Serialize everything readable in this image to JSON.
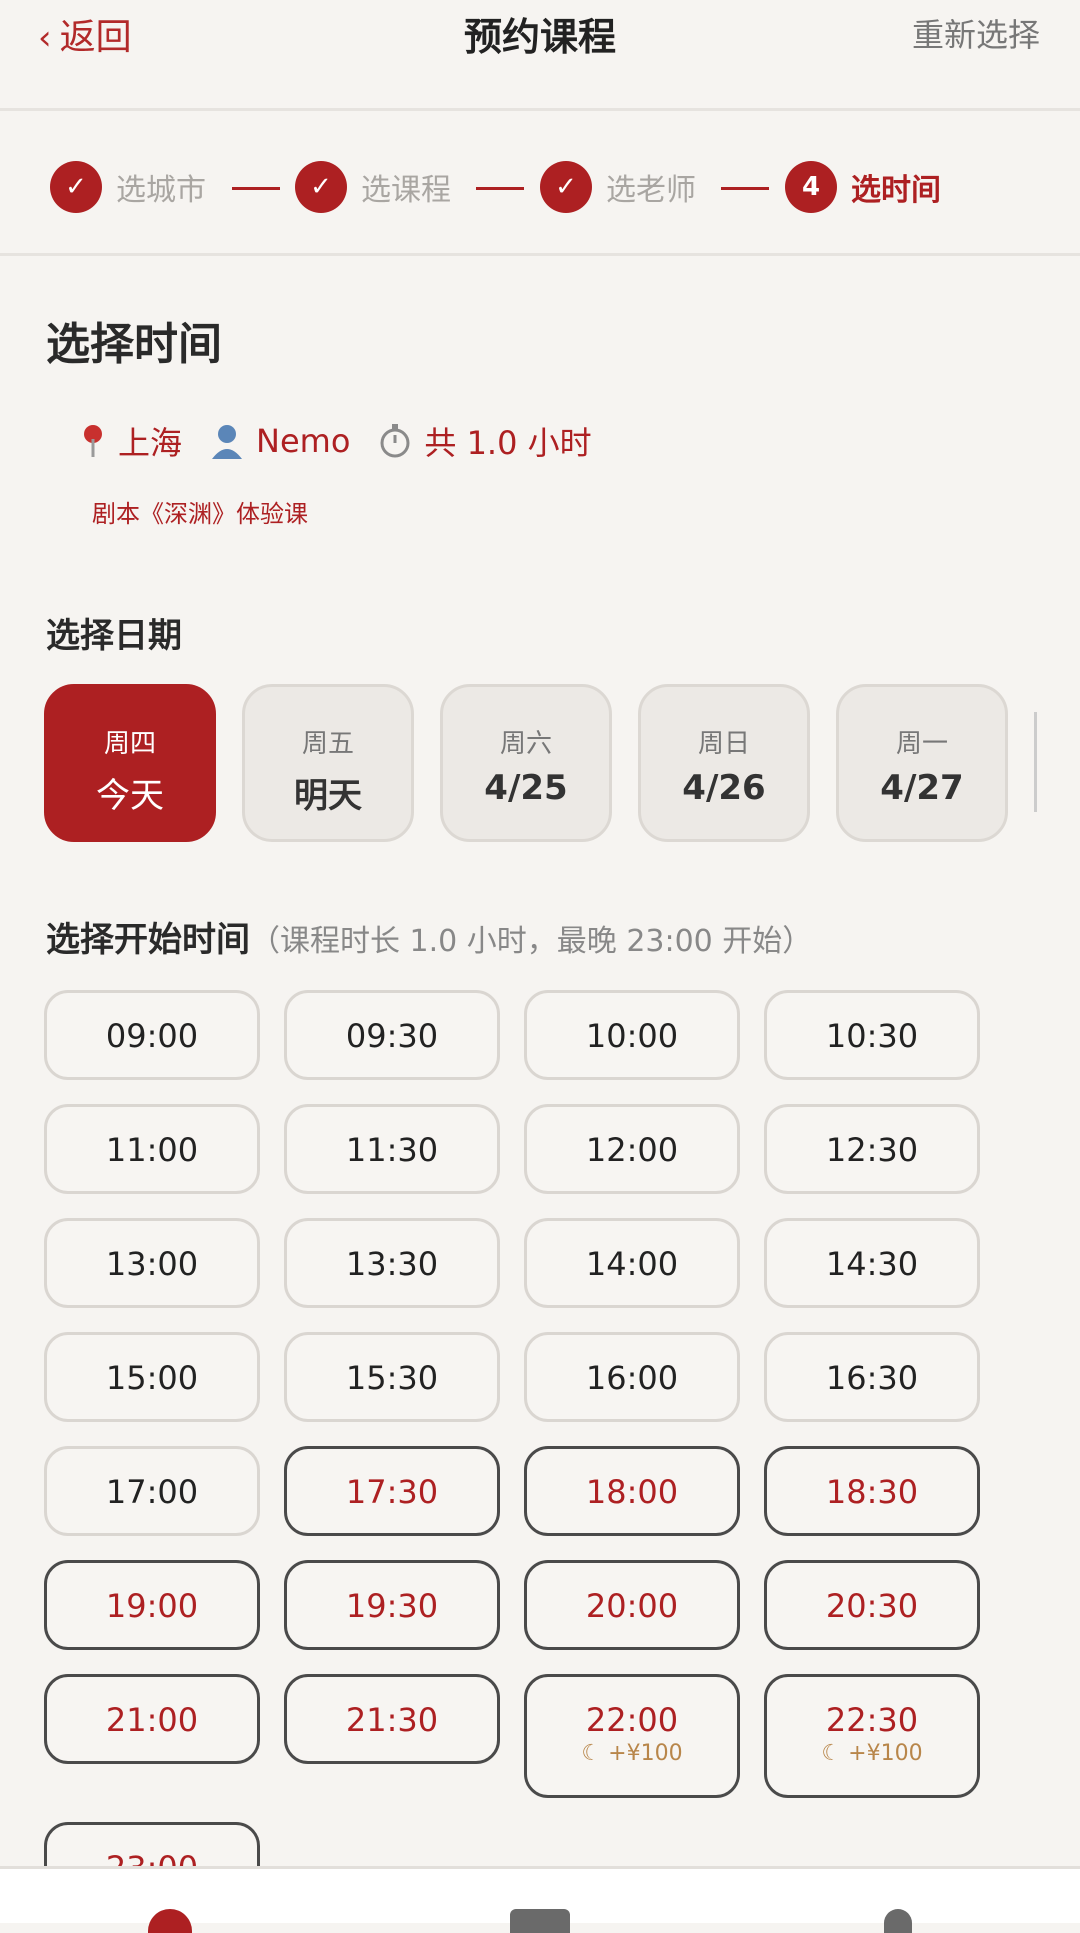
{
  "header": {
    "back_label": "返回",
    "title": "预约课程",
    "reset_label": "重新选择"
  },
  "steps": [
    {
      "mark": "✓",
      "label": "选城市",
      "state": "done"
    },
    {
      "mark": "✓",
      "label": "选课程",
      "state": "done"
    },
    {
      "mark": "✓",
      "label": "选老师",
      "state": "done"
    },
    {
      "mark": "4",
      "label": "选时间",
      "state": "active"
    }
  ],
  "section_title": "选择时间",
  "summary": {
    "city": "上海",
    "teacher": "Nemo",
    "duration": "共 1.0 小时",
    "course": "剧本《深渊》体验课"
  },
  "date_picker": {
    "label": "选择日期",
    "dates": [
      {
        "weekday": "周四",
        "day": "今天",
        "selected": true
      },
      {
        "weekday": "周五",
        "day": "明天",
        "selected": false
      },
      {
        "weekday": "周六",
        "day": "4/25",
        "selected": false
      },
      {
        "weekday": "周日",
        "day": "4/26",
        "selected": false
      },
      {
        "weekday": "周一",
        "day": "4/27",
        "selected": false
      }
    ]
  },
  "time_picker": {
    "label": "选择开始时间",
    "hint": "（课程时长 1.0 小时，最晚 23:00 开始）",
    "slots": [
      {
        "time": "09:00",
        "style": "normal"
      },
      {
        "time": "09:30",
        "style": "normal"
      },
      {
        "time": "10:00",
        "style": "normal"
      },
      {
        "time": "10:30",
        "style": "normal"
      },
      {
        "time": "11:00",
        "style": "normal"
      },
      {
        "time": "11:30",
        "style": "normal"
      },
      {
        "time": "12:00",
        "style": "normal"
      },
      {
        "time": "12:30",
        "style": "normal"
      },
      {
        "time": "13:00",
        "style": "normal"
      },
      {
        "time": "13:30",
        "style": "normal"
      },
      {
        "time": "14:00",
        "style": "normal"
      },
      {
        "time": "14:30",
        "style": "normal"
      },
      {
        "time": "15:00",
        "style": "normal"
      },
      {
        "time": "15:30",
        "style": "normal"
      },
      {
        "time": "16:00",
        "style": "normal"
      },
      {
        "time": "16:30",
        "style": "normal"
      },
      {
        "time": "17:00",
        "style": "normal"
      },
      {
        "time": "17:30",
        "style": "highlight"
      },
      {
        "time": "18:00",
        "style": "highlight"
      },
      {
        "time": "18:30",
        "style": "highlight"
      },
      {
        "time": "19:00",
        "style": "highlight"
      },
      {
        "time": "19:30",
        "style": "highlight"
      },
      {
        "time": "20:00",
        "style": "highlight"
      },
      {
        "time": "20:30",
        "style": "highlight"
      },
      {
        "time": "21:00",
        "style": "highlight"
      },
      {
        "time": "21:30",
        "style": "highlight"
      },
      {
        "time": "22:00",
        "style": "highlight",
        "surcharge": "+¥100"
      },
      {
        "time": "22:30",
        "style": "highlight",
        "surcharge": "+¥100"
      },
      {
        "time": "23:00",
        "style": "highlight"
      }
    ]
  },
  "icons": {
    "pin": "map-pin-icon",
    "teacher": "person-icon",
    "timer": "stopwatch-icon",
    "moon": "moon-icon"
  },
  "colors": {
    "accent": "#ad2022",
    "surcharge": "#b8864a"
  }
}
